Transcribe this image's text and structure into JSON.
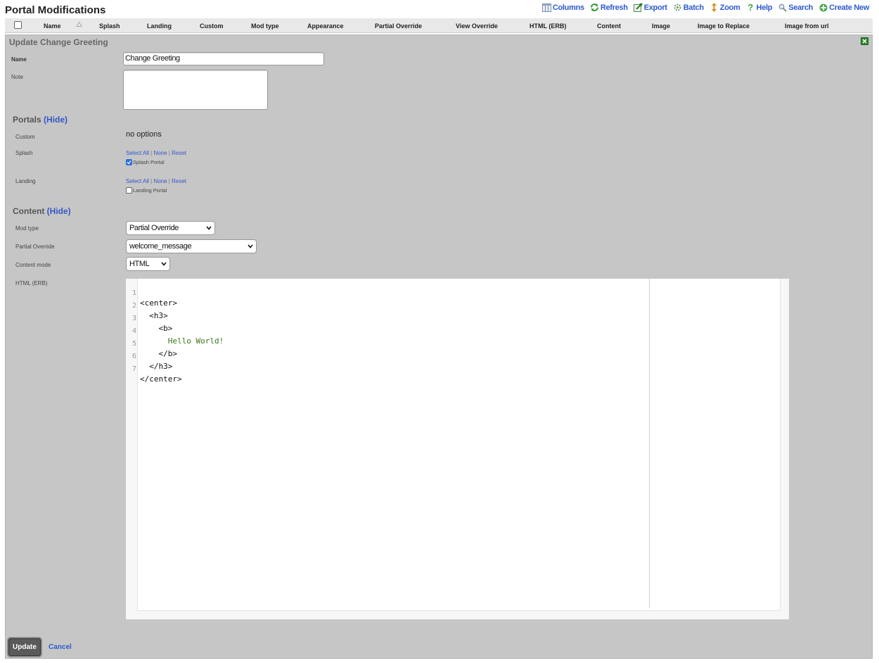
{
  "page": {
    "title": "Portal Modifications"
  },
  "actions": [
    {
      "label": "Columns",
      "icon": "columns-icon",
      "color": "#2c5bd1"
    },
    {
      "label": "Refresh",
      "icon": "refresh-icon"
    },
    {
      "label": "Export",
      "icon": "export-icon"
    },
    {
      "label": "Batch",
      "icon": "batch-icon"
    },
    {
      "label": "Zoom",
      "icon": "zoom-icon"
    },
    {
      "label": "Help",
      "icon": "help-icon"
    },
    {
      "label": "Search",
      "icon": "search-icon"
    },
    {
      "label": "Create New",
      "icon": "create-new-icon"
    }
  ],
  "columns": [
    "Name",
    "Splash",
    "Landing",
    "Custom",
    "Mod type",
    "Appearance",
    "Partial Override",
    "View Override",
    "HTML (ERB)",
    "Content",
    "Image",
    "Image to Replace",
    "Image from url"
  ],
  "form": {
    "title": "Update Change Greeting",
    "name_label": "Name",
    "name_value": "Change Greeting",
    "note_label": "Note",
    "note_value": "",
    "portals": {
      "title": "Portals",
      "hide": "(Hide)",
      "custom_label": "Custom",
      "custom_value": "no options",
      "splash_label": "Splash",
      "landing_label": "Landing",
      "select_all": "Select All",
      "none": "None",
      "reset": "Reset",
      "splash_portal": "Splash Portal",
      "splash_checked": true,
      "landing_portal": "Landing Portal",
      "landing_checked": false
    },
    "content": {
      "title": "Content",
      "hide": "(Hide)",
      "mod_type_label": "Mod type",
      "mod_type_value": "Partial Override",
      "partial_override_label": "Partial Override",
      "partial_override_value": "welcome_message",
      "content_mode_label": "Content mode",
      "content_mode_value": "HTML",
      "html_label": "HTML (ERB)",
      "code_lines": [
        {
          "n": "1",
          "text": "<center>"
        },
        {
          "n": "2",
          "text": "  <h3>"
        },
        {
          "n": "3",
          "text": "    <b>"
        },
        {
          "n": "4",
          "text": "      Hello World!"
        },
        {
          "n": "5",
          "text": "    </b>"
        },
        {
          "n": "6",
          "text": "  </h3>"
        },
        {
          "n": "7",
          "text": "</center>"
        }
      ]
    },
    "update_label": "Update",
    "cancel_label": "Cancel"
  }
}
